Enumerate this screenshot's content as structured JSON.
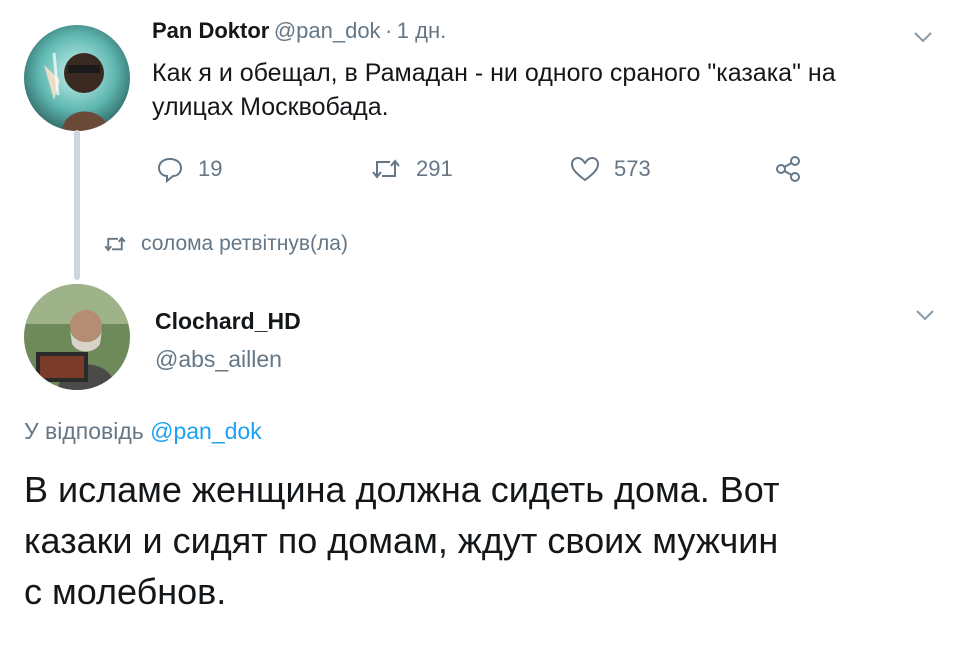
{
  "tweet1": {
    "display_name": "Pan Doktor",
    "handle": "@pan_dok",
    "separator": "·",
    "time": "1 дн.",
    "text_line1": "Как я и обещал, в Рамадан - ни одного сраного \"казака\" на",
    "text_line2": "улицах Москвобада.",
    "replies": "19",
    "retweets": "291",
    "likes": "573"
  },
  "retweet_notice": "солома ретвітнув(ла)",
  "tweet2": {
    "display_name": "Clochard_HD",
    "handle": "@abs_aillen",
    "replying_prefix": "У відповідь",
    "replying_mention": "@pan_dok",
    "text_line1": "В исламе женщина должна сидеть дома. Вот",
    "text_line2": "казаки и сидят по домам, ждут своих мужчин",
    "text_line3": "с молебнов."
  },
  "colors": {
    "accent": "#1da1f2",
    "muted": "#657786",
    "text": "#14171a",
    "line": "#ccd6dd"
  },
  "icons": [
    "reply-icon",
    "retweet-icon",
    "like-icon",
    "share-icon",
    "chevron-down-icon"
  ]
}
